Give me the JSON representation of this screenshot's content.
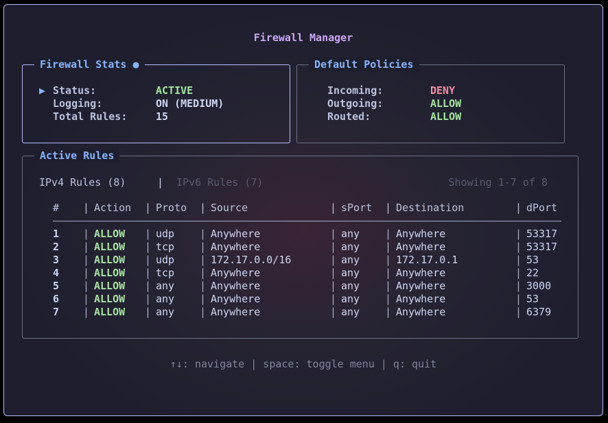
{
  "app": {
    "title": "Firewall Manager"
  },
  "stats": {
    "legend": "Firewall Stats ●",
    "marker": "▶",
    "rows": [
      {
        "label": "Status:",
        "value": "ACTIVE"
      },
      {
        "label": "Logging:",
        "value": "ON (MEDIUM)"
      },
      {
        "label": "Total Rules:",
        "value": "15"
      }
    ]
  },
  "policies": {
    "legend": "Default Policies",
    "rows": [
      {
        "label": "Incoming:",
        "value": "DENY"
      },
      {
        "label": "Outgoing:",
        "value": "ALLOW"
      },
      {
        "label": "Routed:",
        "value": "ALLOW"
      }
    ]
  },
  "rules": {
    "legend": "Active Rules",
    "tabs": {
      "ipv4": "IPv4 Rules (8)",
      "separator": "|",
      "ipv6": "IPv6 Rules (7)"
    },
    "showing": "Showing 1-7 of 8",
    "column_separator": "|",
    "headers": [
      "#",
      "Action",
      "Proto",
      "Source",
      "sPort",
      "Destination",
      "dPort"
    ],
    "rows": [
      [
        "1",
        "ALLOW",
        "udp",
        "Anywhere",
        "any",
        "Anywhere",
        "53317"
      ],
      [
        "2",
        "ALLOW",
        "tcp",
        "Anywhere",
        "any",
        "Anywhere",
        "53317"
      ],
      [
        "3",
        "ALLOW",
        "udp",
        "172.17.0.0/16",
        "any",
        "172.17.0.1",
        "53"
      ],
      [
        "4",
        "ALLOW",
        "tcp",
        "Anywhere",
        "any",
        "Anywhere",
        "22"
      ],
      [
        "5",
        "ALLOW",
        "any",
        "Anywhere",
        "any",
        "Anywhere",
        "3000"
      ],
      [
        "6",
        "ALLOW",
        "any",
        "Anywhere",
        "any",
        "Anywhere",
        "53"
      ],
      [
        "7",
        "ALLOW",
        "any",
        "Anywhere",
        "any",
        "Anywhere",
        "6379"
      ]
    ]
  },
  "footer": {
    "help": "↑↓: navigate | space: toggle menu | q: quit"
  },
  "colors": {
    "accent": "#89b4fa",
    "title": "#cba6f7",
    "allow": "#a6e3a1",
    "deny": "#f38ba8",
    "border_active": "#b4befe"
  }
}
